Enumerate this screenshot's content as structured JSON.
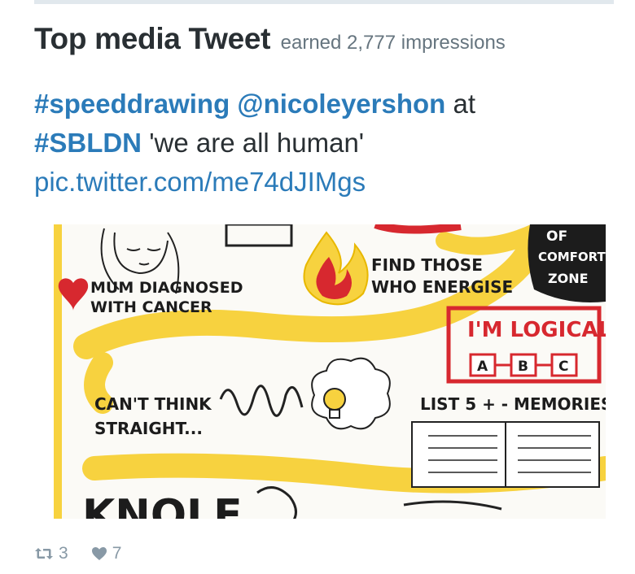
{
  "header": {
    "title": "Top media Tweet",
    "subtitle": "earned 2,777 impressions"
  },
  "tweet": {
    "hashtag1": "#speeddrawing",
    "mention": "@nicoleyershon",
    "text_at": " at",
    "hashtag2": "#SBLDN",
    "quote": " 'we are all human'",
    "link": "pic.twitter.com/me74dJIMgs"
  },
  "media": {
    "notes": {
      "mum": "MUM DIAGNOSED",
      "cancer": "WITH CANCER",
      "find": "FIND THOSE",
      "energise": "WHO ENERGISE",
      "of": "OF",
      "comfort": "COMFORT",
      "zone": "ZONE",
      "logical": "I'M LOGICAL",
      "box_a": "A",
      "box_b": "B",
      "box_c": "C",
      "cant_think": "CAN'T THINK",
      "straight": "STRAIGHT...",
      "list": "LIST 5 + - MEMORIES",
      "knole": "KNOLE"
    },
    "accent_colors": {
      "yellow": "#f7d23f",
      "red": "#d7282f",
      "black": "#1c1c1c"
    }
  },
  "actions": {
    "retweets": "3",
    "likes": "7"
  },
  "colors": {
    "link": "#2b7bb9",
    "text": "#292f33",
    "muted": "#66757f",
    "icon": "#8899a6"
  }
}
